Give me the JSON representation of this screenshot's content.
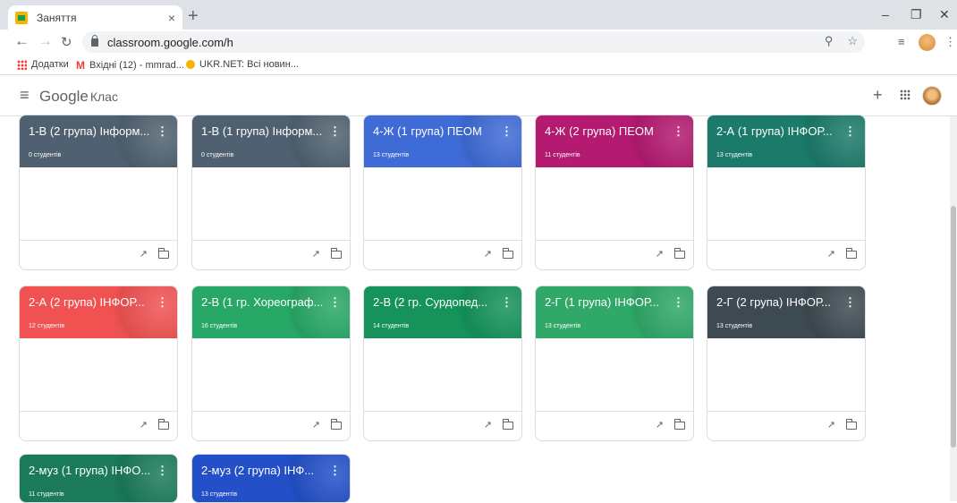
{
  "browser": {
    "tab_title": "Заняття",
    "tab_close": "×",
    "new_tab": "+",
    "url": "classroom.google.com/h",
    "bookmarks": [
      {
        "label": "Додатки",
        "icon": "apps-icon"
      },
      {
        "label": "Вхідні (12) - mmrad...",
        "icon": "gmail-icon"
      },
      {
        "label": "UKR.NET: Всі новин...",
        "icon": "ukrnet-icon"
      }
    ]
  },
  "app": {
    "logo_google": "Google",
    "logo_product": "Клас"
  },
  "colors": {
    "gray": "#4a5a66",
    "blue": "#3f6bd6",
    "magenta": "#b31a70",
    "teal": "#1b7a6a",
    "red": "#f05252",
    "green": "#1e9a5a",
    "dark": "#3e4a52",
    "indigo": "#2350c8"
  },
  "classes": [
    {
      "name": "1-В (2 група) Інформ...",
      "students": "0 студентів",
      "color": "#4f6170"
    },
    {
      "name": "1-В (1 група) Інформ...",
      "students": "0 студентів",
      "color": "#4f6170"
    },
    {
      "name": "4-Ж (1 група) ПЕОМ",
      "students": "13 студентів",
      "color": "#3f6bd6"
    },
    {
      "name": "4-Ж (2 група) ПЕОМ",
      "students": "11 студентів",
      "color": "#b31a70"
    },
    {
      "name": "2-А (1 група) ІНФОР...",
      "students": "13 студентів",
      "color": "#1b7a6a"
    },
    {
      "name": "2-А (2 група) ІНФОР...",
      "students": "12 студентів",
      "color": "#f05252"
    },
    {
      "name": "2-В (1 гр. Хореограф...",
      "students": "16 студентів",
      "color": "#28a866"
    },
    {
      "name": "2-В (2 гр. Сурдопед...",
      "students": "14 студентів",
      "color": "#15935a"
    },
    {
      "name": "2-Г (1 група) ІНФОР...",
      "students": "13 студентів",
      "color": "#2fa868"
    },
    {
      "name": "2-Г (2 група) ІНФОР...",
      "students": "13 студентів",
      "color": "#3e4a52"
    },
    {
      "name": "2-муз (1 група) ІНФО...",
      "students": "11 студентів",
      "color": "#1b7a5a"
    },
    {
      "name": "2-муз (2 група) ІНФ...",
      "students": "13 студентів",
      "color": "#2350c8"
    }
  ]
}
